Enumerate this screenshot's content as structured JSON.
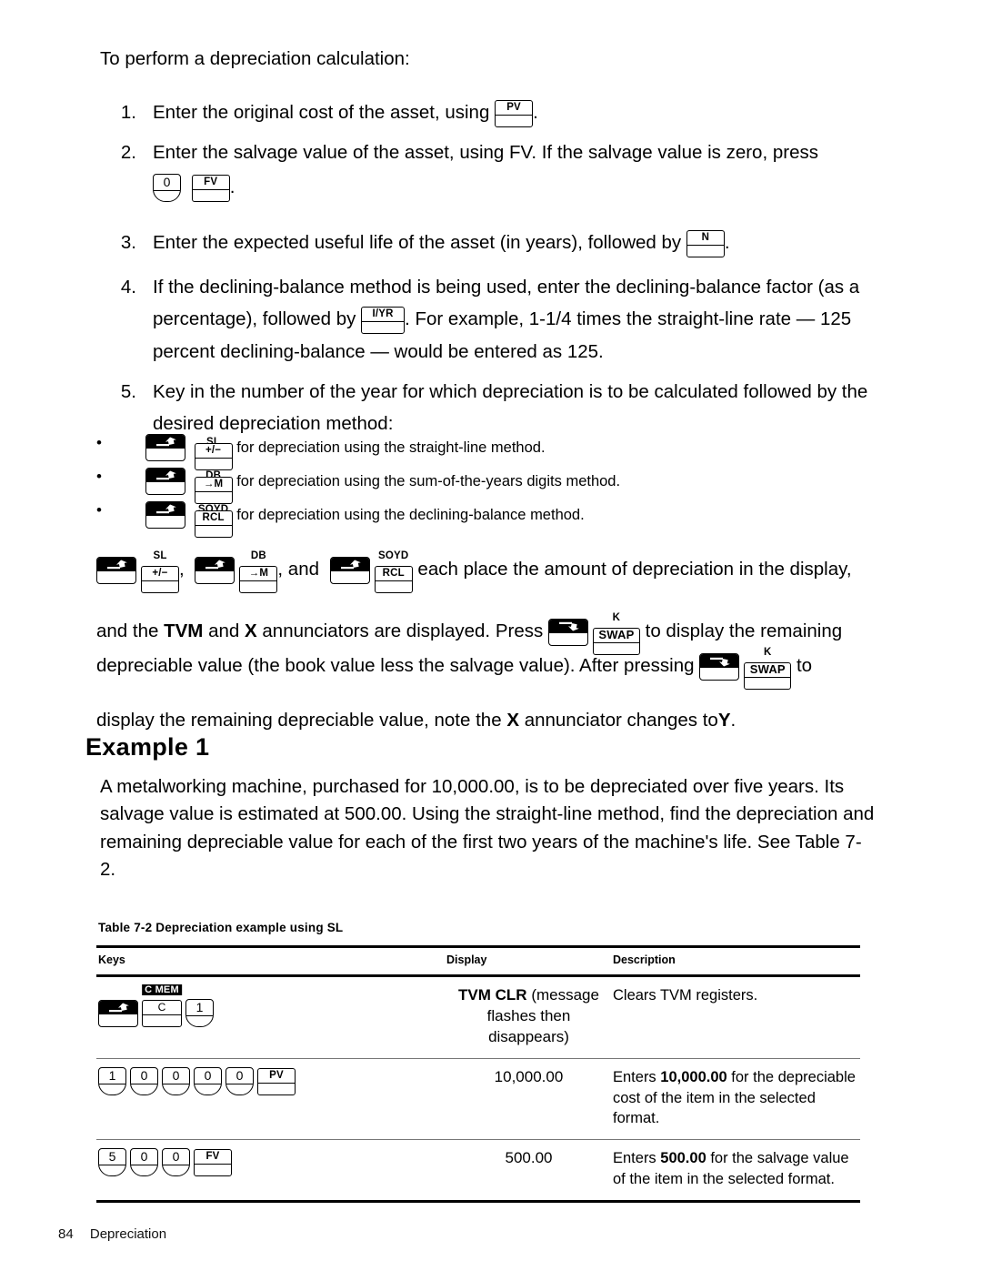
{
  "intro": "To perform a depreciation calculation:",
  "steps": [
    {
      "num": "1.",
      "pre": "Enter the original cost of the asset, using",
      "keys": [
        {
          "type": "fn",
          "label": "PV"
        }
      ],
      "post": "."
    },
    {
      "num": "2.",
      "pre": "Enter the salvage value of the asset, using FV. If the salvage value is zero, press",
      "keys": [
        {
          "type": "digit",
          "label": "0"
        },
        {
          "type": "fn",
          "label": "FV"
        }
      ],
      "post": ".",
      "keys_on_new_line": true
    },
    {
      "num": "3.",
      "pre": "Enter the expected useful life of the asset (in years), followed by",
      "keys": [
        {
          "type": "fn",
          "label": "N"
        }
      ],
      "post": "."
    },
    {
      "num": "4.",
      "pre": "If the declining-balance method is being used, enter the declining-balance factor (as a percentage), followed by",
      "keys": [
        {
          "type": "fn",
          "label": "I/YR"
        }
      ],
      "post": ". For example, 1-1/4 times the straight-line rate — 125 percent declining-balance — would be entered as 125."
    },
    {
      "num": "5.",
      "pre": "Key in the number of the year for which depreciation is to be calculated followed by the desired depreciation method:",
      "keys": [],
      "post": ""
    }
  ],
  "methods": [
    {
      "bullet": "•",
      "shift": "up",
      "over": "SL",
      "key": "+/−",
      "text": "for depreciation using the straight-line method."
    },
    {
      "bullet": "•",
      "shift": "up",
      "over": "DB",
      "key": "→M",
      "text": "for depreciation using the sum-of-the-years digits method."
    },
    {
      "bullet": "•",
      "shift": "up",
      "over": "SOYD",
      "key": "RCL",
      "text": "for depreciation using the declining-balance method."
    }
  ],
  "paragraph_place": {
    "seq1_over": "SL",
    "seq1_key": "+/−",
    "sep1": ",",
    "seq2_over": "DB",
    "seq2_key": "→M",
    "sep2": ", and",
    "seq3_over": "SOYD",
    "seq3_key": "RCL",
    "tail": "each place the amount of depreciation in the display,"
  },
  "paragraph_line2": {
    "a": "and the",
    "tvm": "TVM",
    "b": "and",
    "x": "X",
    "c": "annunciators are displayed. Press",
    "swap_over": "K",
    "swap_key": "SWAP",
    "d": "to display the remaining"
  },
  "paragraph_deprec": {
    "a": "depreciable value (the book value less the salvage value). After pressing",
    "swap_over": "K",
    "swap_key": "SWAP",
    "b": "to",
    "c": "display the remaining depreciable value, note the",
    "x": "X",
    "d": "annunciator changes to",
    "y": "Y",
    "e": "."
  },
  "example": {
    "heading": "Example 1",
    "body": "A metalworking machine, purchased for 10,000.00, is to be depreciated over five years. Its salvage value is estimated at 500.00. Using the straight-line method, find the depreciation and remaining depreciable value for each of the first two years of the machine's life. See Table 7-2."
  },
  "table": {
    "caption": "Table 7-2  Depreciation example using SL",
    "headers": [
      "Keys",
      "Display",
      "Description"
    ],
    "rows": [
      {
        "keys": [
          {
            "type": "shift",
            "dir": "up"
          },
          {
            "type": "fn",
            "label": "C",
            "over": "C MEM",
            "inverse": true,
            "width": "cmem"
          },
          {
            "type": "digit",
            "label": "1"
          }
        ],
        "display_bold": "TVM CLR",
        "display_rest": "(message flashes then disappears)",
        "description_parts": [
          {
            "t": "Clears TVM registers.",
            "b": false
          }
        ]
      },
      {
        "keys": [
          {
            "type": "digit",
            "label": "1"
          },
          {
            "type": "digit",
            "label": "0"
          },
          {
            "type": "digit",
            "label": "0"
          },
          {
            "type": "digit",
            "label": "0"
          },
          {
            "type": "digit",
            "label": "0"
          },
          {
            "type": "fn",
            "label": "PV"
          }
        ],
        "display_bold": "",
        "display_rest": "10,000.00",
        "description_parts": [
          {
            "t": "Enters ",
            "b": false
          },
          {
            "t": "10,000.00",
            "b": true
          },
          {
            "t": " for the depreciable cost of the item in the selected format.",
            "b": false
          }
        ]
      },
      {
        "keys": [
          {
            "type": "digit",
            "label": "5"
          },
          {
            "type": "digit",
            "label": "0"
          },
          {
            "type": "digit",
            "label": "0"
          },
          {
            "type": "fn",
            "label": "FV"
          }
        ],
        "display_bold": "",
        "display_rest": "500.00",
        "description_parts": [
          {
            "t": "Enters ",
            "b": false
          },
          {
            "t": "500.00",
            "b": true
          },
          {
            "t": " for the salvage value of the item in the selected format.",
            "b": false
          }
        ]
      }
    ]
  },
  "footer": {
    "page_number": "84",
    "section": "Depreciation"
  }
}
